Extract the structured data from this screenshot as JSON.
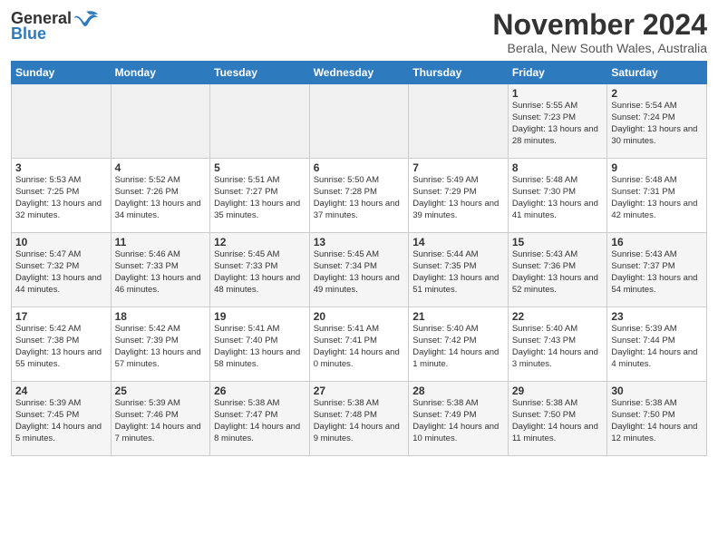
{
  "header": {
    "logo_general": "General",
    "logo_blue": "Blue",
    "month_title": "November 2024",
    "subtitle": "Berala, New South Wales, Australia"
  },
  "weekdays": [
    "Sunday",
    "Monday",
    "Tuesday",
    "Wednesday",
    "Thursday",
    "Friday",
    "Saturday"
  ],
  "weeks": [
    [
      {
        "day": "",
        "info": ""
      },
      {
        "day": "",
        "info": ""
      },
      {
        "day": "",
        "info": ""
      },
      {
        "day": "",
        "info": ""
      },
      {
        "day": "",
        "info": ""
      },
      {
        "day": "1",
        "info": "Sunrise: 5:55 AM\nSunset: 7:23 PM\nDaylight: 13 hours and 28 minutes."
      },
      {
        "day": "2",
        "info": "Sunrise: 5:54 AM\nSunset: 7:24 PM\nDaylight: 13 hours and 30 minutes."
      }
    ],
    [
      {
        "day": "3",
        "info": "Sunrise: 5:53 AM\nSunset: 7:25 PM\nDaylight: 13 hours and 32 minutes."
      },
      {
        "day": "4",
        "info": "Sunrise: 5:52 AM\nSunset: 7:26 PM\nDaylight: 13 hours and 34 minutes."
      },
      {
        "day": "5",
        "info": "Sunrise: 5:51 AM\nSunset: 7:27 PM\nDaylight: 13 hours and 35 minutes."
      },
      {
        "day": "6",
        "info": "Sunrise: 5:50 AM\nSunset: 7:28 PM\nDaylight: 13 hours and 37 minutes."
      },
      {
        "day": "7",
        "info": "Sunrise: 5:49 AM\nSunset: 7:29 PM\nDaylight: 13 hours and 39 minutes."
      },
      {
        "day": "8",
        "info": "Sunrise: 5:48 AM\nSunset: 7:30 PM\nDaylight: 13 hours and 41 minutes."
      },
      {
        "day": "9",
        "info": "Sunrise: 5:48 AM\nSunset: 7:31 PM\nDaylight: 13 hours and 42 minutes."
      }
    ],
    [
      {
        "day": "10",
        "info": "Sunrise: 5:47 AM\nSunset: 7:32 PM\nDaylight: 13 hours and 44 minutes."
      },
      {
        "day": "11",
        "info": "Sunrise: 5:46 AM\nSunset: 7:33 PM\nDaylight: 13 hours and 46 minutes."
      },
      {
        "day": "12",
        "info": "Sunrise: 5:45 AM\nSunset: 7:33 PM\nDaylight: 13 hours and 48 minutes."
      },
      {
        "day": "13",
        "info": "Sunrise: 5:45 AM\nSunset: 7:34 PM\nDaylight: 13 hours and 49 minutes."
      },
      {
        "day": "14",
        "info": "Sunrise: 5:44 AM\nSunset: 7:35 PM\nDaylight: 13 hours and 51 minutes."
      },
      {
        "day": "15",
        "info": "Sunrise: 5:43 AM\nSunset: 7:36 PM\nDaylight: 13 hours and 52 minutes."
      },
      {
        "day": "16",
        "info": "Sunrise: 5:43 AM\nSunset: 7:37 PM\nDaylight: 13 hours and 54 minutes."
      }
    ],
    [
      {
        "day": "17",
        "info": "Sunrise: 5:42 AM\nSunset: 7:38 PM\nDaylight: 13 hours and 55 minutes."
      },
      {
        "day": "18",
        "info": "Sunrise: 5:42 AM\nSunset: 7:39 PM\nDaylight: 13 hours and 57 minutes."
      },
      {
        "day": "19",
        "info": "Sunrise: 5:41 AM\nSunset: 7:40 PM\nDaylight: 13 hours and 58 minutes."
      },
      {
        "day": "20",
        "info": "Sunrise: 5:41 AM\nSunset: 7:41 PM\nDaylight: 14 hours and 0 minutes."
      },
      {
        "day": "21",
        "info": "Sunrise: 5:40 AM\nSunset: 7:42 PM\nDaylight: 14 hours and 1 minute."
      },
      {
        "day": "22",
        "info": "Sunrise: 5:40 AM\nSunset: 7:43 PM\nDaylight: 14 hours and 3 minutes."
      },
      {
        "day": "23",
        "info": "Sunrise: 5:39 AM\nSunset: 7:44 PM\nDaylight: 14 hours and 4 minutes."
      }
    ],
    [
      {
        "day": "24",
        "info": "Sunrise: 5:39 AM\nSunset: 7:45 PM\nDaylight: 14 hours and 5 minutes."
      },
      {
        "day": "25",
        "info": "Sunrise: 5:39 AM\nSunset: 7:46 PM\nDaylight: 14 hours and 7 minutes."
      },
      {
        "day": "26",
        "info": "Sunrise: 5:38 AM\nSunset: 7:47 PM\nDaylight: 14 hours and 8 minutes."
      },
      {
        "day": "27",
        "info": "Sunrise: 5:38 AM\nSunset: 7:48 PM\nDaylight: 14 hours and 9 minutes."
      },
      {
        "day": "28",
        "info": "Sunrise: 5:38 AM\nSunset: 7:49 PM\nDaylight: 14 hours and 10 minutes."
      },
      {
        "day": "29",
        "info": "Sunrise: 5:38 AM\nSunset: 7:50 PM\nDaylight: 14 hours and 11 minutes."
      },
      {
        "day": "30",
        "info": "Sunrise: 5:38 AM\nSunset: 7:50 PM\nDaylight: 14 hours and 12 minutes."
      }
    ]
  ]
}
